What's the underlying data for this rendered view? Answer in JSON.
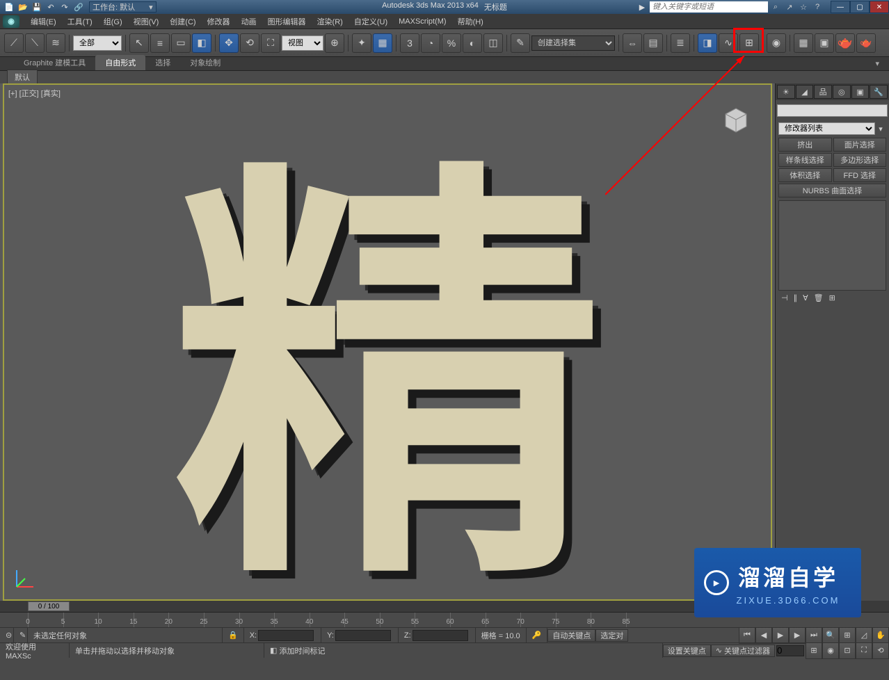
{
  "titlebar": {
    "workspace_label": "工作台: 默认",
    "app_title": "Autodesk 3ds Max  2013 x64",
    "doc_title": "无标题",
    "search_placeholder": "键入关键字或短语"
  },
  "menubar": {
    "items": [
      "编辑(E)",
      "工具(T)",
      "组(G)",
      "视图(V)",
      "创建(C)",
      "修改器",
      "动画",
      "图形编辑器",
      "渲染(R)",
      "自定义(U)",
      "MAXScript(M)",
      "帮助(H)"
    ]
  },
  "toolbar": {
    "filter_all": "全部",
    "ref_coord": "视图",
    "selection_set": "创建选择集"
  },
  "ribbon": {
    "tabs": [
      "Graphite 建模工具",
      "自由形式",
      "选择",
      "对象绘制"
    ],
    "subtabs": [
      "默认"
    ]
  },
  "viewport": {
    "label": "[+] [正交] [真实]",
    "character": "精"
  },
  "command_panel": {
    "modifier_list": "修改器列表",
    "buttons": [
      "挤出",
      "面片选择",
      "样条线选择",
      "多边形选择",
      "体积选择",
      "FFD 选择"
    ],
    "nurbs_label": "NURBS 曲面选择"
  },
  "timeline": {
    "slider_label": "0 / 100",
    "ticks": [
      0,
      5,
      10,
      15,
      20,
      25,
      30,
      35,
      40,
      45,
      50,
      55,
      60,
      65,
      70,
      75,
      80,
      85
    ]
  },
  "status": {
    "prompt1": "未选定任何对象",
    "prompt2": "单击并拖动以选择并移动对象",
    "welcome": "欢迎使用 MAXSc",
    "x_label": "X:",
    "y_label": "Y:",
    "z_label": "Z:",
    "grid": "栅格 = 10.0",
    "autokey": "自动关键点",
    "selected_label": "选定对",
    "setkey": "设置关键点",
    "key_filter": "关键点过滤器",
    "add_time_tag": "添加时间标记"
  },
  "watermark": {
    "main": "溜溜自学",
    "sub": "ZIXUE.3D66.COM"
  },
  "icons": {
    "new": "new",
    "open": "open",
    "save": "save",
    "undo": "undo",
    "redo": "redo"
  }
}
